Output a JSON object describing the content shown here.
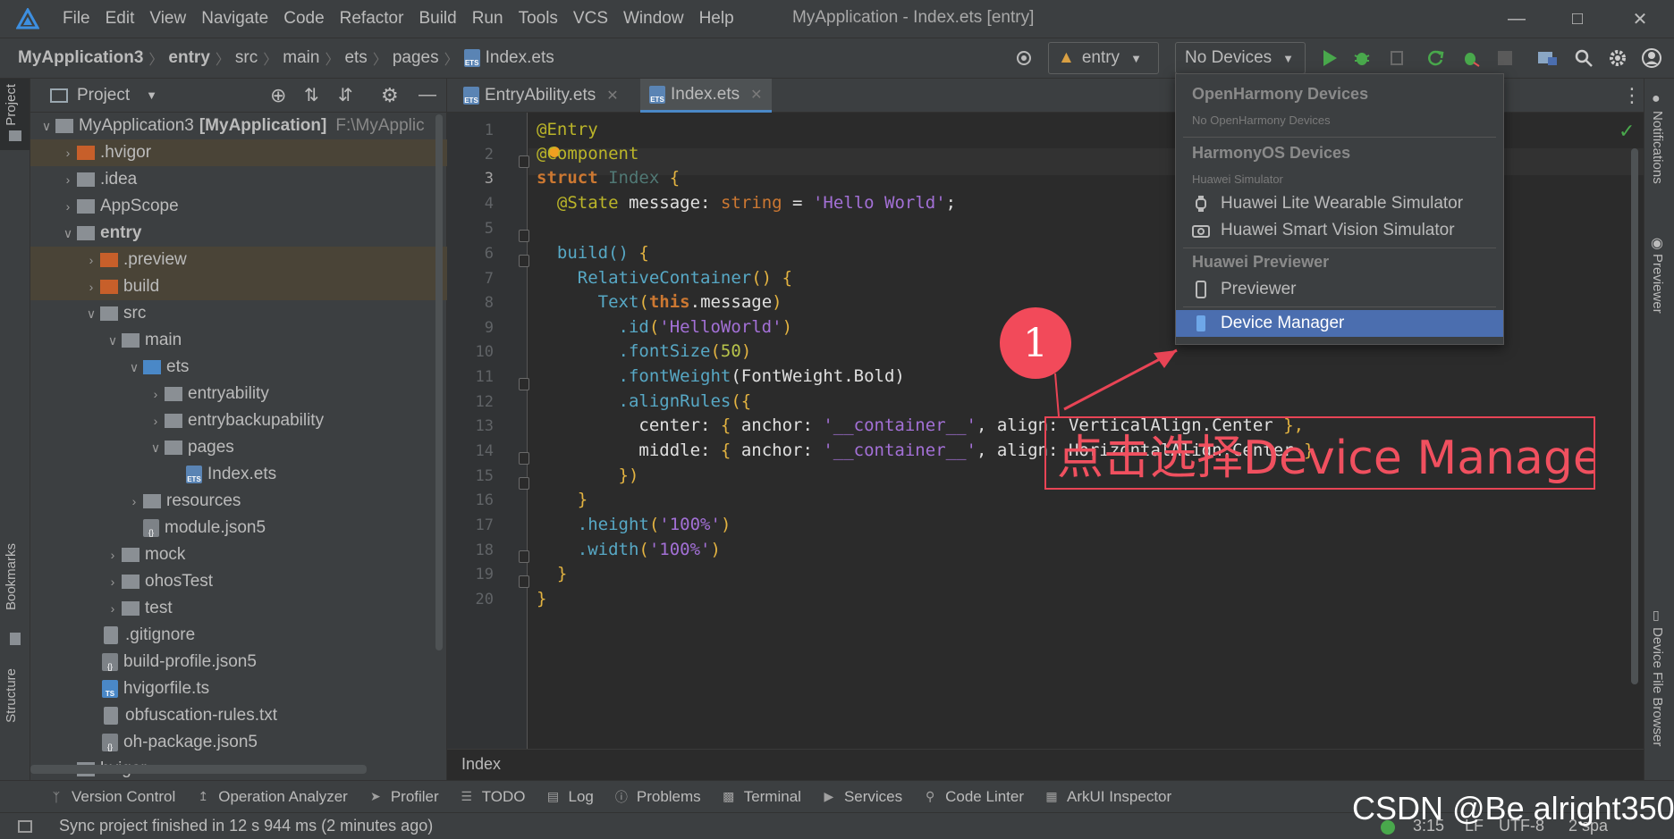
{
  "titlebar": {
    "menu": [
      "File",
      "Edit",
      "View",
      "Navigate",
      "Code",
      "Refactor",
      "Build",
      "Run",
      "Tools",
      "VCS",
      "Window",
      "Help"
    ],
    "title": "MyApplication - Index.ets [entry]"
  },
  "navbar": {
    "breadcrumb": [
      "MyApplication3",
      "entry",
      "src",
      "main",
      "ets",
      "pages",
      "Index.ets"
    ],
    "module_select": "entry",
    "device_select": "No Devices"
  },
  "left_strip": {
    "project_tab": "Project",
    "bookmarks_tab": "Bookmarks",
    "structure_tab": "Structure"
  },
  "project": {
    "header": "Project",
    "root_name": "MyApplication3",
    "root_module": "[MyApplication]",
    "root_path": "F:\\MyApplic",
    "items": [
      {
        "label": ".hvigor"
      },
      {
        "label": ".idea"
      },
      {
        "label": "AppScope"
      },
      {
        "label": "entry"
      },
      {
        "label": ".preview"
      },
      {
        "label": "build"
      },
      {
        "label": "src"
      },
      {
        "label": "main"
      },
      {
        "label": "ets"
      },
      {
        "label": "entryability"
      },
      {
        "label": "entrybackupability"
      },
      {
        "label": "pages"
      },
      {
        "label": "Index.ets"
      },
      {
        "label": "resources"
      },
      {
        "label": "module.json5"
      },
      {
        "label": "mock"
      },
      {
        "label": "ohosTest"
      },
      {
        "label": "test"
      },
      {
        "label": ".gitignore"
      },
      {
        "label": "build-profile.json5"
      },
      {
        "label": "hvigorfile.ts"
      },
      {
        "label": "obfuscation-rules.txt"
      },
      {
        "label": "oh-package.json5"
      },
      {
        "label": "hvigor"
      }
    ]
  },
  "editor": {
    "tabs": [
      {
        "label": "EntryAbility.ets"
      },
      {
        "label": "Index.ets"
      }
    ],
    "line_numbers": [
      "1",
      "2",
      "3",
      "4",
      "5",
      "6",
      "7",
      "8",
      "9",
      "10",
      "11",
      "12",
      "13",
      "14",
      "15",
      "16",
      "17",
      "18",
      "19",
      "20"
    ],
    "code": {
      "l1": "@Entry",
      "l2": "@Component",
      "l3a": "struct",
      "l3b": "Index",
      "l3c": "{",
      "l4a": "@State",
      "l4b": "message:",
      "l4c": "string",
      "l4d": "=",
      "l4e": "'Hello World'",
      "l4f": ";",
      "l6a": "build()",
      "l6b": "{",
      "l7a": "RelativeContainer",
      "l7b": "()",
      "l7c": "{",
      "l8a": "Text",
      "l8b": "(",
      "l8c": "this",
      "l8d": ".message",
      "l8e": ")",
      "l9a": ".id",
      "l9b": "(",
      "l9c": "'HelloWorld'",
      "l9d": ")",
      "l10a": ".fontSize",
      "l10b": "(",
      "l10c": "50",
      "l10d": ")",
      "l11a": ".fontWeight",
      "l11b": "(FontWeight.Bold)",
      "l12a": ".alignRules",
      "l12b": "({",
      "l13a": "center:",
      "l13b": "{",
      "l13c": "anchor:",
      "l13d": "'__container__'",
      "l13e": ",",
      "l13f": "align:",
      "l13g": "VerticalAlign.Center",
      "l13h": "},",
      "l14a": "middle:",
      "l14b": "{",
      "l14c": "anchor:",
      "l14d": "'__container__'",
      "l14e": ",",
      "l14f": "align:",
      "l14g": "HorizontalAlign.Center",
      "l14h": "}",
      "l15": "})",
      "l16": "}",
      "l17a": ".height",
      "l17b": "(",
      "l17c": "'100%'",
      "l17d": ")",
      "l18a": ".width",
      "l18b": "(",
      "l18c": "'100%'",
      "l18d": ")",
      "l19": "}",
      "l20": "}"
    },
    "bottom_crumb": "Index"
  },
  "device_popup": {
    "openharmony_header": "OpenHarmony Devices",
    "openharmony_sub": "No OpenHarmony Devices",
    "harmonyos_header": "HarmonyOS Devices",
    "harmonyos_sub": "Huawei Simulator",
    "wearable": "Huawei Lite Wearable Simulator",
    "smart_vision": "Huawei Smart Vision Simulator",
    "previewer_header": "Huawei Previewer",
    "previewer": "Previewer",
    "device_manager": "Device Manager"
  },
  "right_strip": {
    "notifications": "Notifications",
    "previewer": "Previewer",
    "device_file_browser": "Device File Browser"
  },
  "bottom_tools": [
    "Version Control",
    "Operation Analyzer",
    "Profiler",
    "TODO",
    "Log",
    "Problems",
    "Terminal",
    "Services",
    "Code Linter",
    "ArkUI Inspector"
  ],
  "status": {
    "message": "Sync project finished in 12 s 944 ms (2 minutes ago)",
    "position": "3:15",
    "line_sep": "LF",
    "encoding": "UTF-8",
    "indent": "2 spa"
  },
  "annotation": {
    "number": "1",
    "text": "点击选择Device Manager"
  },
  "watermark": "CSDN @Be alright350",
  "colors": {
    "accent": "#4b6eaf",
    "annotation": "#f24a5a",
    "run_green": "#49a84c"
  }
}
